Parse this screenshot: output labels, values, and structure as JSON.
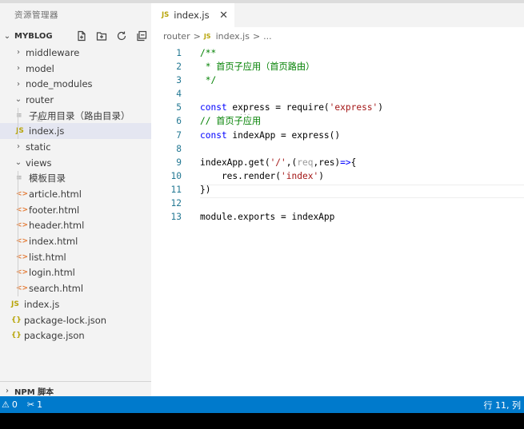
{
  "sidebar": {
    "title": "资源管理器",
    "section": "MYBLOG",
    "items": [
      {
        "label": "middleware",
        "type": "folder",
        "state": "collapsed",
        "depth": 0
      },
      {
        "label": "model",
        "type": "folder",
        "state": "collapsed",
        "depth": 0
      },
      {
        "label": "node_modules",
        "type": "folder",
        "state": "collapsed",
        "depth": 0
      },
      {
        "label": "router",
        "type": "folder",
        "state": "expanded",
        "depth": 0
      },
      {
        "label": "子应用目录（路由目录）",
        "type": "doc",
        "depth": 1
      },
      {
        "label": "index.js",
        "type": "js",
        "depth": 1,
        "selected": true
      },
      {
        "label": "static",
        "type": "folder",
        "state": "collapsed",
        "depth": 0
      },
      {
        "label": "views",
        "type": "folder",
        "state": "expanded",
        "depth": 0
      },
      {
        "label": "模板目录",
        "type": "doc",
        "depth": 1
      },
      {
        "label": "article.html",
        "type": "html",
        "depth": 1
      },
      {
        "label": "footer.html",
        "type": "html",
        "depth": 1
      },
      {
        "label": "header.html",
        "type": "html",
        "depth": 1
      },
      {
        "label": "index.html",
        "type": "html",
        "depth": 1
      },
      {
        "label": "list.html",
        "type": "html",
        "depth": 1
      },
      {
        "label": "login.html",
        "type": "html",
        "depth": 1
      },
      {
        "label": "search.html",
        "type": "html",
        "depth": 1
      },
      {
        "label": "index.js",
        "type": "js",
        "depth": 0
      },
      {
        "label": "package-lock.json",
        "type": "json",
        "depth": 0
      },
      {
        "label": "package.json",
        "type": "json",
        "depth": 0
      }
    ],
    "npm_section": "NPM 脚本"
  },
  "icons": {
    "js": "JS",
    "json": "{}",
    "html": "<>",
    "doc": "≡",
    "collapsed": "›",
    "expanded": "⌄"
  },
  "editor": {
    "tab": {
      "icon": "JS",
      "name": "index.js",
      "close": "✕"
    },
    "breadcrumb": {
      "folder": "router",
      "sep1": ">",
      "icon": "JS",
      "file": "index.js",
      "sep2": ">",
      "more": "..."
    },
    "lines": [
      {
        "n": "1",
        "tokens": [
          {
            "t": "/**",
            "c": "com"
          }
        ]
      },
      {
        "n": "2",
        "tokens": [
          {
            "t": " * 首页子应用（首页路由）",
            "c": "com"
          }
        ]
      },
      {
        "n": "3",
        "tokens": [
          {
            "t": " */",
            "c": "com"
          }
        ]
      },
      {
        "n": "4",
        "tokens": []
      },
      {
        "n": "5",
        "tokens": [
          {
            "t": "const",
            "c": "kw"
          },
          {
            "t": " express = require(",
            "c": "plain"
          },
          {
            "t": "'express'",
            "c": "str"
          },
          {
            "t": ")",
            "c": "plain"
          }
        ]
      },
      {
        "n": "6",
        "tokens": [
          {
            "t": "// 首页子应用",
            "c": "com"
          }
        ]
      },
      {
        "n": "7",
        "tokens": [
          {
            "t": "const",
            "c": "kw"
          },
          {
            "t": " indexApp = express()",
            "c": "plain"
          }
        ]
      },
      {
        "n": "8",
        "tokens": []
      },
      {
        "n": "9",
        "tokens": [
          {
            "t": "indexApp.get(",
            "c": "plain"
          },
          {
            "t": "'/'",
            "c": "str"
          },
          {
            "t": ",(",
            "c": "plain"
          },
          {
            "t": "req",
            "c": "dim"
          },
          {
            "t": ",res)",
            "c": "plain"
          },
          {
            "t": "=>",
            "c": "kw"
          },
          {
            "t": "{",
            "c": "plain"
          }
        ]
      },
      {
        "n": "10",
        "tokens": [
          {
            "t": "    res.render(",
            "c": "plain"
          },
          {
            "t": "'index'",
            "c": "str"
          },
          {
            "t": ")",
            "c": "plain"
          }
        ]
      },
      {
        "n": "11",
        "tokens": [
          {
            "t": "})",
            "c": "plain"
          }
        ]
      },
      {
        "n": "12",
        "tokens": []
      },
      {
        "n": "13",
        "tokens": [
          {
            "t": "module.exports = indexApp",
            "c": "plain"
          }
        ]
      }
    ],
    "active_line": 11
  },
  "status": {
    "warnings": "0",
    "tools": "1",
    "position": "行 11, 列"
  },
  "colors": {
    "statusbar": "#007acc",
    "sidebar_bg": "#f3f3f3",
    "selected_row": "#e4e6f1",
    "keyword": "#0000ff",
    "string": "#a31515",
    "comment": "#008000"
  }
}
